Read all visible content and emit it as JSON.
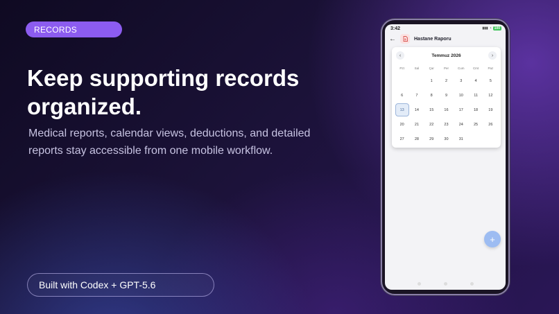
{
  "badge": {
    "label": "RECORDS"
  },
  "headline": {
    "line1": "Keep supporting records",
    "line2": "organized."
  },
  "subtitle": {
    "line1": "Medical reports, calendar views, deductions, and detailed",
    "line2": "reports stay accessible from one mobile workflow."
  },
  "built_with": {
    "label": "Built with Codex + GPT-5.6"
  },
  "phone": {
    "status": {
      "time": "3:42",
      "battery": "100"
    },
    "app_title": "Hastane Raporu",
    "calendar": {
      "month_label": "Temmuz 2026",
      "weekdays": [
        "Pzt",
        "Sal",
        "Çar",
        "Per",
        "Cum",
        "Cmt",
        "Paz"
      ],
      "days": [
        "",
        "",
        "1",
        "2",
        "3",
        "4",
        "5",
        "6",
        "7",
        "8",
        "9",
        "10",
        "11",
        "12",
        "13",
        "14",
        "15",
        "16",
        "17",
        "18",
        "19",
        "20",
        "21",
        "22",
        "23",
        "24",
        "25",
        "26",
        "27",
        "28",
        "29",
        "30",
        "31",
        "",
        ""
      ],
      "selected_day": "13"
    },
    "fab_label": "+"
  },
  "colors": {
    "badge_bg": "#8c5cf0",
    "fab": "#9dbcf2",
    "selected_day_border": "#9cb5da"
  }
}
